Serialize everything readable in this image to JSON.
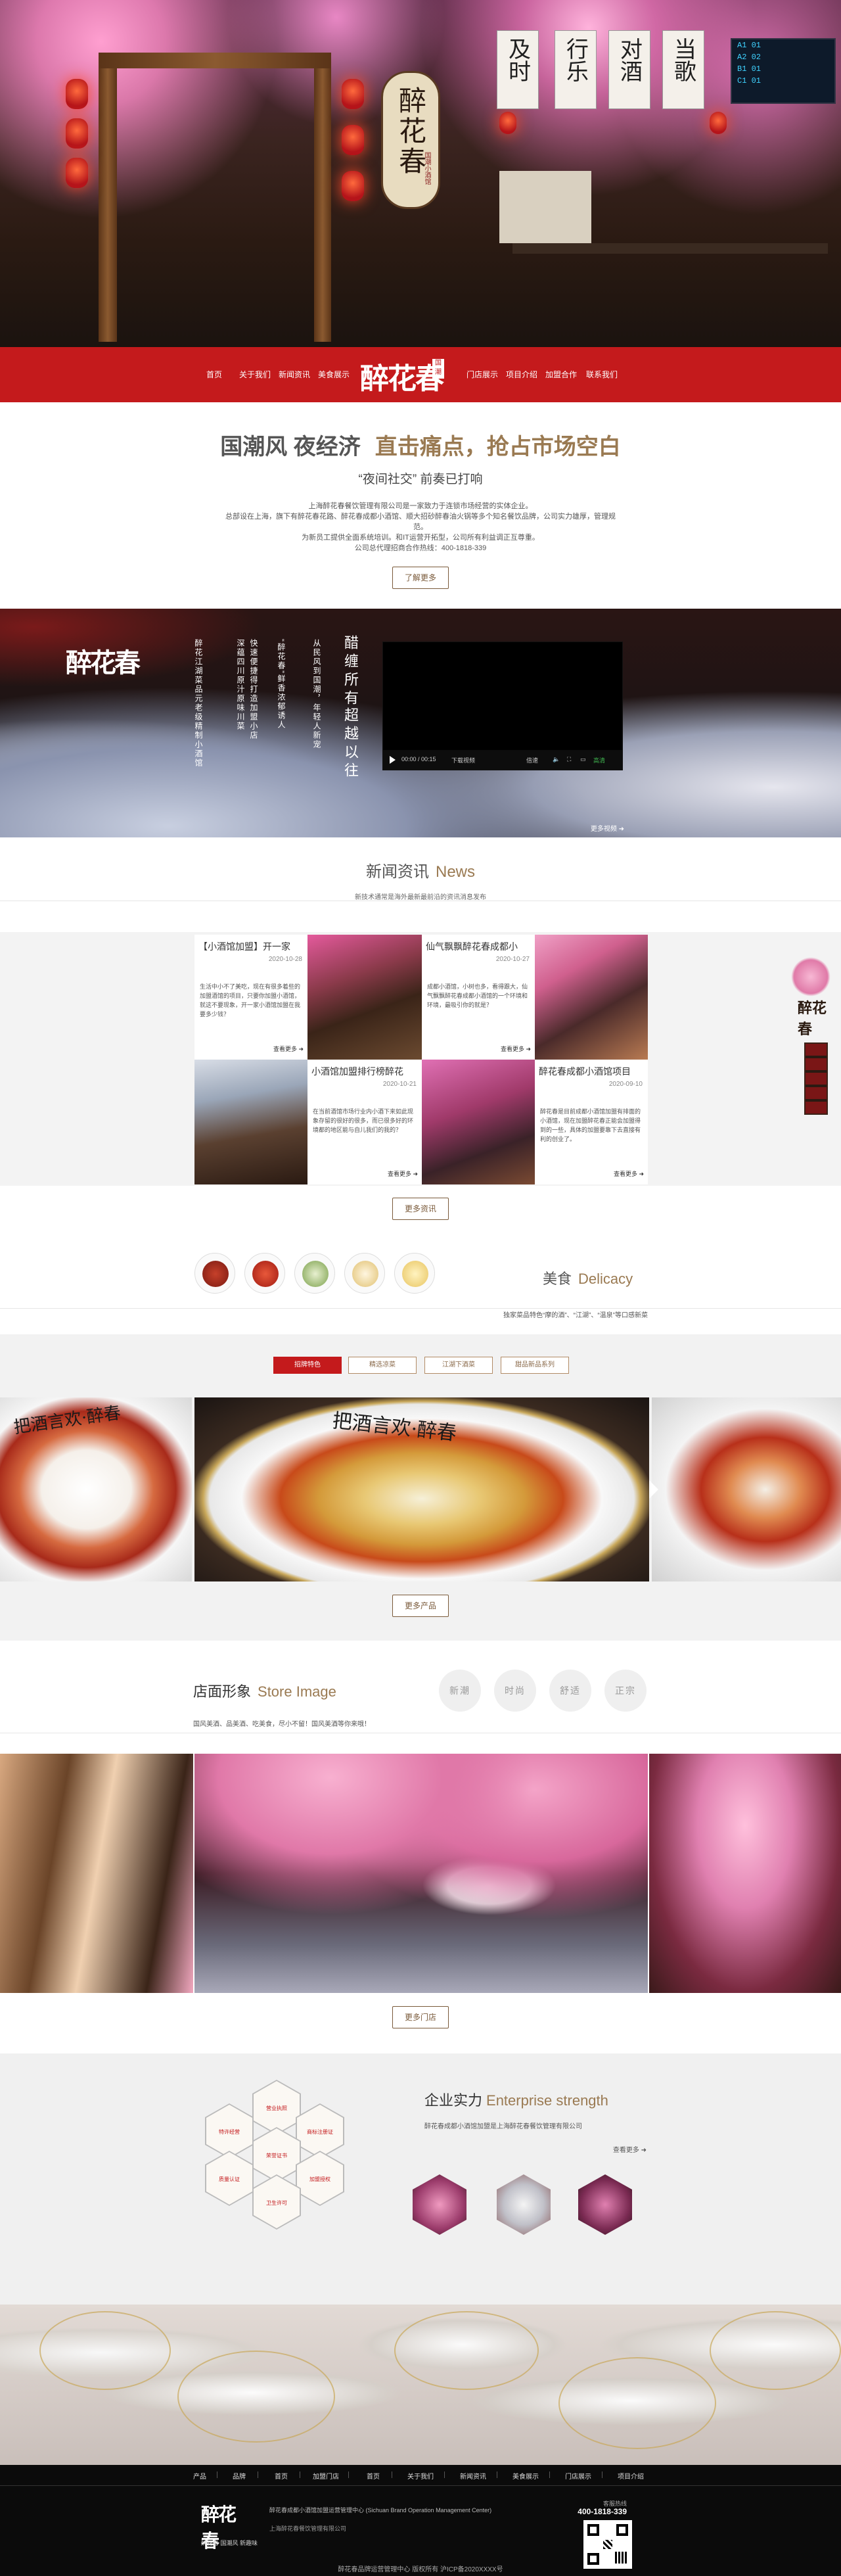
{
  "nav": {
    "left_items": [
      "首页",
      "关于我们",
      "新闻资讯",
      "美食展示"
    ],
    "right_items": [
      "门店展示",
      "项目介绍",
      "加盟合作",
      "联系我们"
    ],
    "logo_text": "醉花春",
    "logo_seal": "国潮"
  },
  "hero": {
    "sign_main": "醉花春",
    "sign_small": "国潮小酒馆",
    "hanging_signs": [
      "及时",
      "行乐",
      "对酒",
      "当歌"
    ],
    "scoreboard": [
      "A1   01",
      "A2   02",
      "B1   01",
      "C1   01"
    ]
  },
  "intro": {
    "title_left": "国潮风 夜经济",
    "title_right": "直击痛点，抢占市场空白",
    "subtitle": "“夜间社交”  前奏已打响",
    "body": [
      "上海醉花春餐饮管理有限公司是一家致力于连锁市场经营的实体企业。",
      "总部设在上海，旗下有醉花春花路、醉花春成都小酒馆、顺大招砂醉春油火锅等多个知名餐饮品牌，公司实力雄厚，管理规范。",
      "为新员工提供全面系统培训。和IT运营开拓型，公司所有利益调正互尊重。",
      "公司总代理招商合作热线：400-1818-339"
    ],
    "button": "了解更多"
  },
  "video": {
    "logo": "醉花春",
    "headline_1": "醋缠所有",
    "headline_2": "超越以往",
    "columns": [
      "醉花江湖菜品元老级精制小酒馆",
      "深蕴四川原汁原味川菜",
      "快速便捷得打造加盟小店",
      "“醉花春”鲜香浓郁诱人",
      "从民风到国潮，年轻人新宠"
    ],
    "player_time": "00:00 / 00:15",
    "player_download": "下载视频",
    "player_speed": "倍速",
    "player_hd": "高清",
    "more": "更多视频"
  },
  "news": {
    "title": "新闻资讯",
    "title_en": "News",
    "subtitle": "新技术通常是海外最新最前沿的资讯消息发布",
    "items": [
      {
        "title": "【小酒馆加盟】开一家",
        "date": "2020-10-28",
        "desc": "生活中小不了美吃，现在有很多着些的加盟酒馆的项目，只要你加盟小酒馆，就这不要现象，开一家小酒馆加盟在我要多少钱？",
        "more": "查看更多"
      },
      {
        "title": "仙气飘飘醉花春成都小",
        "date": "2020-10-27",
        "desc": "成都小酒馆，小树也多，看得跟大，仙气飘飘醉花春成都小酒馆的一个环境和环境，最吸引你的就是？",
        "more": "查看更多"
      },
      {
        "title": "小酒馆加盟排行榜醉花",
        "date": "2020-10-21",
        "desc": "在当前酒馆市场行业内小酒下来如此现象存留的很好的很多，而已很多好的环境都的地区能与自儿我们的我的？",
        "more": "查看更多"
      },
      {
        "title": "醉花春成都小酒馆项目",
        "date": "2020-09-10",
        "desc": "醉花春是目前成都小酒馆加盟有排面的小酒馆，现在加盟醉花春正能会加盟得到的一些，具体的加盟要靠下去直接有利的创业了。",
        "more": "查看更多"
      }
    ],
    "button": "更多资讯"
  },
  "food": {
    "title": "美食",
    "title_en": "Delicacy",
    "subtitle": "独家菜品特色“摩的酒”、“江湖”、“温泉”等口感新菜",
    "tabs": [
      "招牌特色",
      "精选凉菜",
      "江湖下酒菜",
      "甜品新品系列"
    ],
    "active_tab": 0,
    "button": "更多产品",
    "plate_text": "把酒言欢·醉春"
  },
  "store": {
    "title": "店面形象",
    "title_en": "Store Image",
    "subtitle": "国风美酒、品美酒、吃美食，尽小不留！国风美酒等你来哦！",
    "badges": [
      "新潮",
      "时尚",
      "舒适",
      "正宗"
    ],
    "button": "更多门店"
  },
  "strength": {
    "title": "企业实力",
    "title_en": "Enterprise strength",
    "subtitle": "醉花春成都小酒馆加盟是上海醉花春餐饮管理有限公司",
    "more": "查看更多",
    "certs": [
      "营业执照",
      "商标注册证",
      "特许经营",
      "荣誉证书",
      "质量认证",
      "加盟授权",
      "卫生许可"
    ]
  },
  "footer": {
    "nav": [
      "产品",
      "品牌",
      "首页",
      "加盟门店",
      "首页",
      "关于我们",
      "新闻资讯",
      "美食展示",
      "门店展示",
      "项目介绍"
    ],
    "logo": "醉花春",
    "tags": "醉花春  国潮风  新趣味",
    "company": "醉花春成都小酒馆加盟运营管理中心 (Sichuan Brand Operation Management Center)",
    "company2": "上海醉花春餐饮管理有限公司",
    "hotline_label": "客服热线",
    "hotline": "400-1818-339",
    "copyright": "醉花春品牌运营管理中心 版权所有 沪ICP备2020XXXX号"
  },
  "colors": {
    "primary": "#c41a1c",
    "accent": "#9a7a52",
    "dark": "#0b0b0b"
  }
}
